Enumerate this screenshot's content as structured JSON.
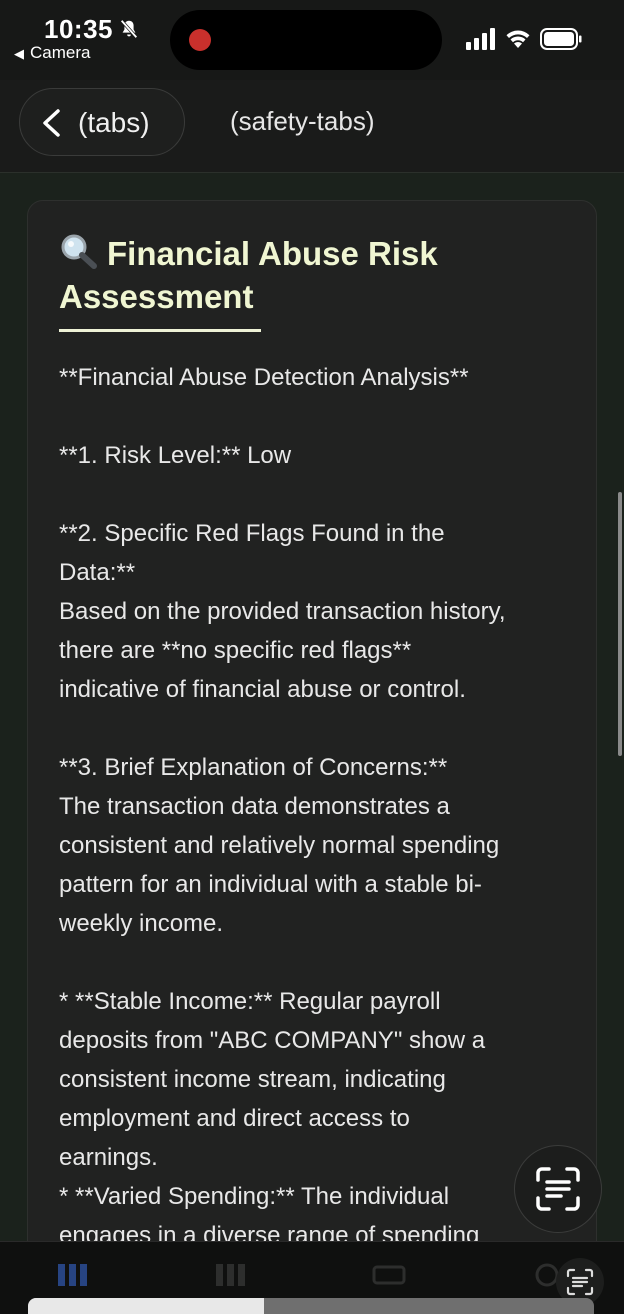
{
  "status_bar": {
    "time": "10:35",
    "back_app": "Camera",
    "recording_color": "#c9302c"
  },
  "header": {
    "back_label": "(tabs)",
    "title": "(safety-tabs)"
  },
  "card": {
    "title": "Financial Abuse Risk Assessment",
    "title_icon": "magnifying-glass-icon",
    "accent_color": "#f0f6d2",
    "lines": [
      "**Financial Abuse Detection Analysis**",
      "",
      "**1. Risk Level:** Low",
      "",
      "**2. Specific Red Flags Found in the",
      "Data:**",
      "Based on the provided transaction history,",
      "there are **no specific red flags**",
      "indicative of financial abuse or control.",
      "",
      "**3. Brief Explanation of Concerns:**",
      "The transaction data demonstrates a",
      "consistent and relatively normal spending",
      "pattern for an individual with a stable bi-",
      "weekly income.",
      "",
      "*   **Stable Income:** Regular payroll",
      "deposits from \"ABC COMPANY\" show a",
      "consistent income stream, indicating",
      "employment and direct access to",
      "earnings.",
      "*   **Varied Spending:** The individual",
      "engages in a diverse range of spending"
    ]
  },
  "fab": {
    "icon": "text-scan-icon"
  },
  "tabbar": {
    "tabs": [
      "home-tab-icon",
      "chart-tab-icon",
      "card-tab-icon",
      "settings-tab-icon"
    ],
    "corner_icon": "text-scan-icon"
  }
}
